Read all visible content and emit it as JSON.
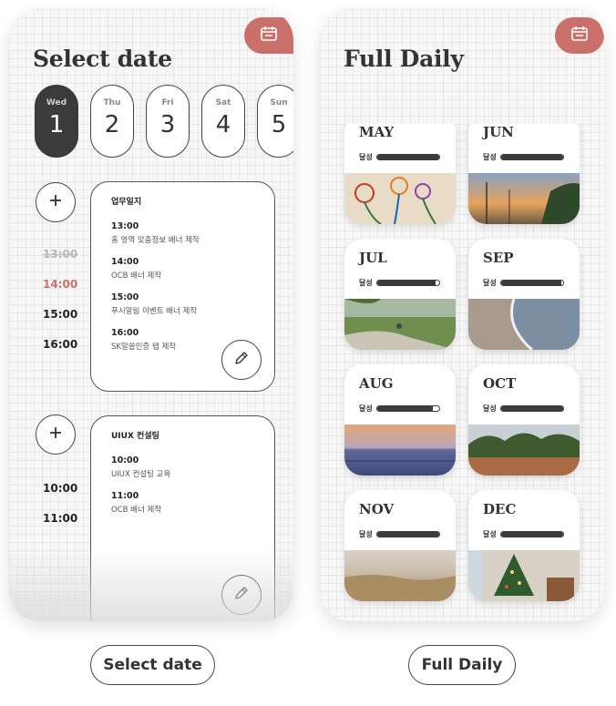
{
  "left_screen": {
    "title": "Select date",
    "calendar_icon": "calendar-icon",
    "dates": [
      {
        "dow": "Wed",
        "num": "1",
        "active": true
      },
      {
        "dow": "Thu",
        "num": "2",
        "active": false
      },
      {
        "dow": "Fri",
        "num": "3",
        "active": false
      },
      {
        "dow": "Sat",
        "num": "4",
        "active": false
      },
      {
        "dow": "Sun",
        "num": "5",
        "active": false
      }
    ],
    "group1": {
      "times": [
        "13:00",
        "14:00",
        "15:00",
        "16:00"
      ],
      "card_title": "업무일지",
      "entries": [
        {
          "time": "13:00",
          "desc": "홈 영역 맞춤정보 배너 제작"
        },
        {
          "time": "14:00",
          "desc": "OCB 배너 제작"
        },
        {
          "time": "15:00",
          "desc": "푸시알림 이벤트 배너 제작"
        },
        {
          "time": "16:00",
          "desc": "SK알쓸인증 탭 제작"
        }
      ]
    },
    "group2": {
      "times": [
        "10:00",
        "11:00"
      ],
      "card_title": "UIUX 컨설팅",
      "entries": [
        {
          "time": "10:00",
          "desc": "UIUX 컨설팅 교육"
        },
        {
          "time": "11:00",
          "desc": "OCB 배너 제작"
        }
      ]
    }
  },
  "right_screen": {
    "title": "Full Daily",
    "calendar_icon": "calendar-icon",
    "progress_label": "달성",
    "months": [
      {
        "name": "MAY",
        "progress": 1.0,
        "photo": "flowers-drawing"
      },
      {
        "name": "JUN",
        "progress": 1.0,
        "photo": "sunset-road"
      },
      {
        "name": "JUL",
        "progress": 0.95,
        "photo": "park-path"
      },
      {
        "name": "SEP",
        "progress": 0.97,
        "photo": "beach-shore"
      },
      {
        "name": "AUG",
        "progress": 0.9,
        "photo": "sea-horizon"
      },
      {
        "name": "OCT",
        "progress": 1.0,
        "photo": "field-trees"
      },
      {
        "name": "NOV",
        "progress": 1.0,
        "photo": "reed-field"
      },
      {
        "name": "DEC",
        "progress": 1.0,
        "photo": "christmas-tree"
      }
    ]
  },
  "captions": {
    "left": "Select date",
    "right": "Full Daily"
  },
  "colors": {
    "accent": "#c9706a",
    "dark": "#3b3b3b"
  }
}
